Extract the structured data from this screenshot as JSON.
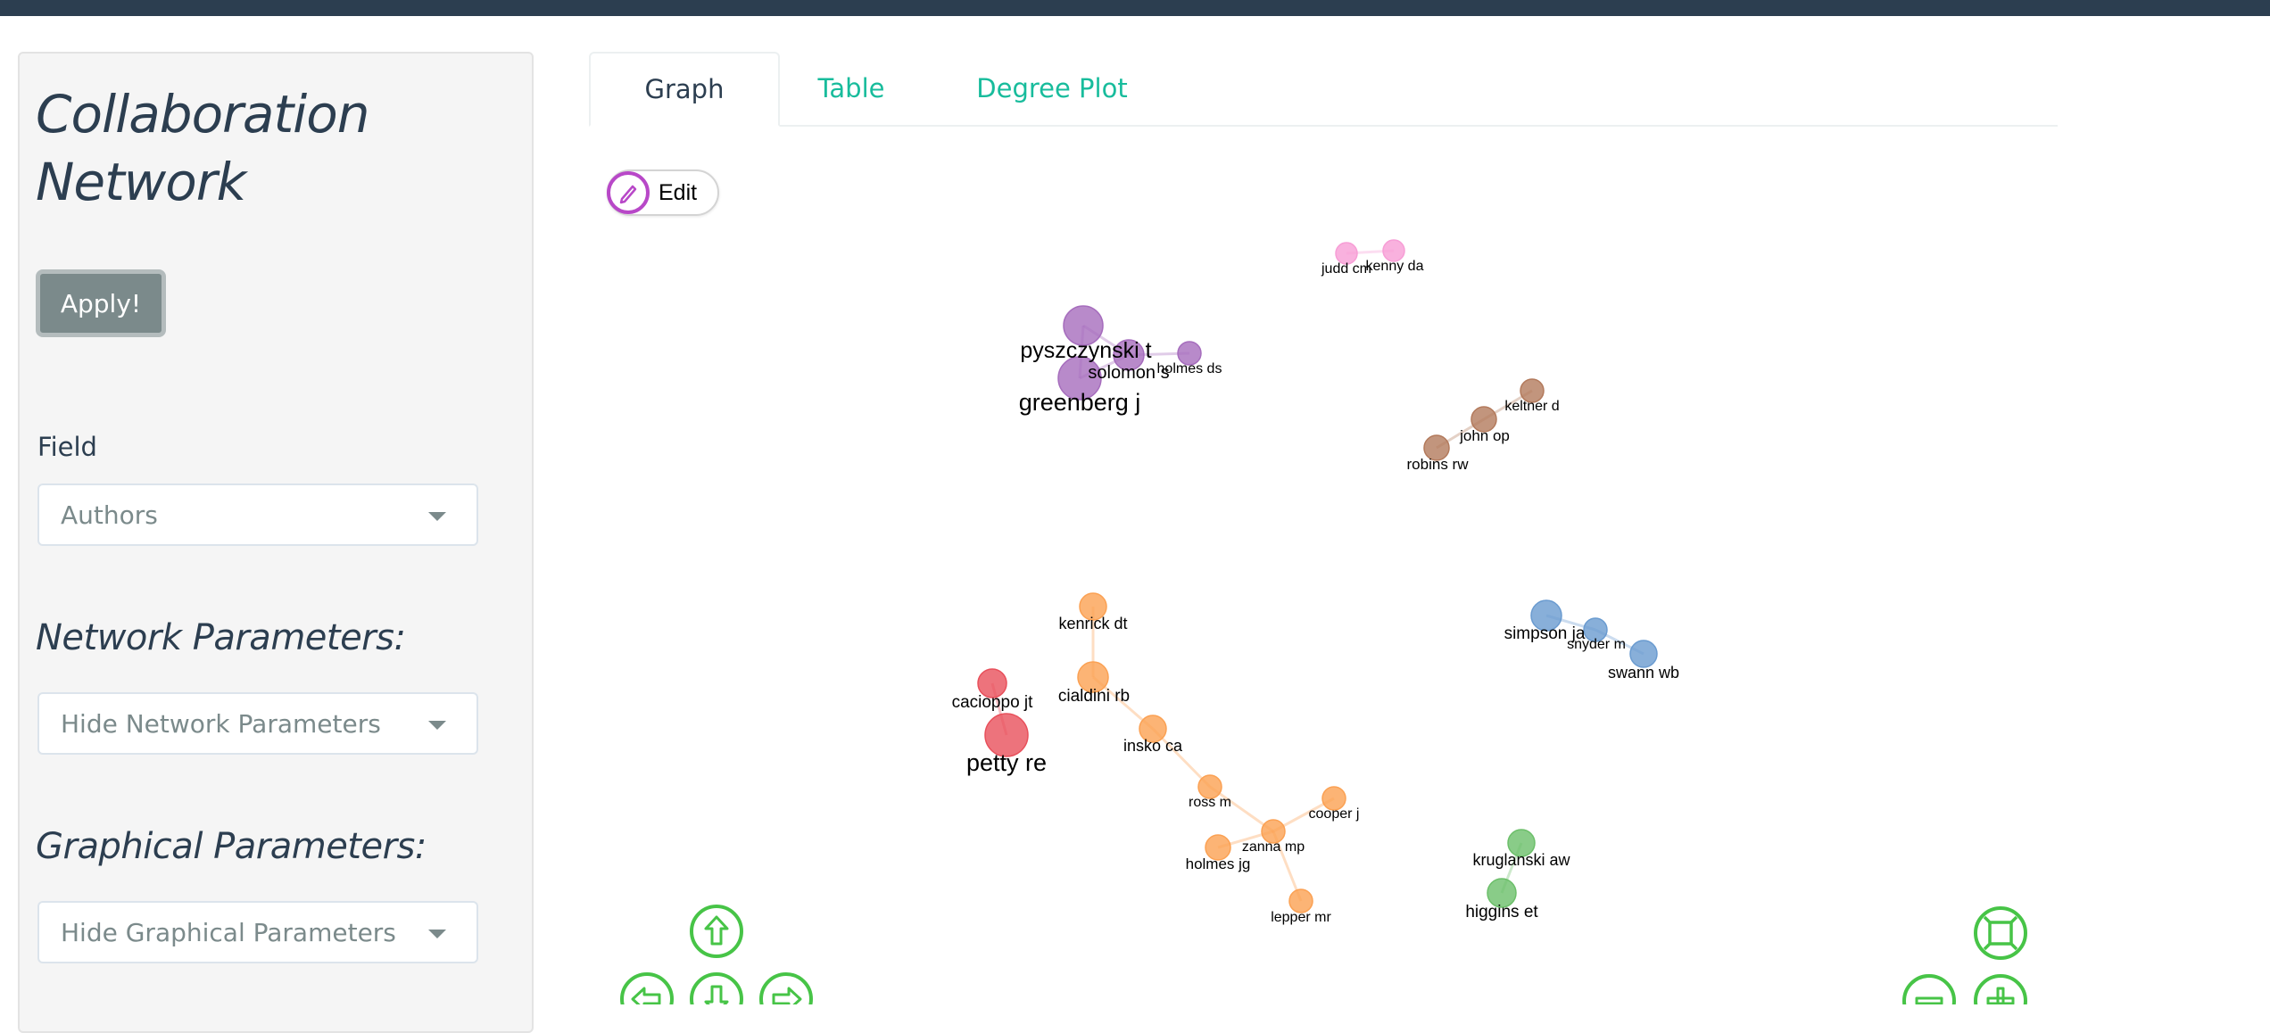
{
  "sidebar": {
    "title": "Collaboration Network",
    "apply_label": "Apply!",
    "field_label": "Field",
    "field_value": "Authors",
    "network_heading": "Network Parameters:",
    "network_select": "Hide Network Parameters",
    "graphical_heading": "Graphical Parameters:",
    "graphical_select": "Hide Graphical Parameters"
  },
  "tabs": [
    {
      "label": "Graph",
      "active": true
    },
    {
      "label": "Table",
      "active": false
    },
    {
      "label": "Degree Plot",
      "active": false
    }
  ],
  "graph": {
    "edit_label": "Edit",
    "node_colors": {
      "pink": "#f79ed6",
      "purple": "#a66dbd",
      "brown": "#b37a5c",
      "blue": "#6a9bd0",
      "orange": "#fba153",
      "red": "#e8505b",
      "green": "#6cbf6a"
    },
    "nodes": [
      {
        "id": "judd",
        "label": "judd cm",
        "color": "pink"
      },
      {
        "id": "kenny",
        "label": "kenny da",
        "color": "pink"
      },
      {
        "id": "pyszczynski",
        "label": "pyszczynski t",
        "color": "purple"
      },
      {
        "id": "solomon",
        "label": "solomon s",
        "color": "purple"
      },
      {
        "id": "holmesds",
        "label": "holmes ds",
        "color": "purple"
      },
      {
        "id": "greenberg",
        "label": "greenberg j",
        "color": "purple"
      },
      {
        "id": "keltner",
        "label": "keltner d",
        "color": "brown"
      },
      {
        "id": "john",
        "label": "john op",
        "color": "brown"
      },
      {
        "id": "robins",
        "label": "robins rw",
        "color": "brown"
      },
      {
        "id": "kenrick",
        "label": "kenrick dt",
        "color": "orange"
      },
      {
        "id": "cialdini",
        "label": "cialdini rb",
        "color": "orange"
      },
      {
        "id": "cacioppo",
        "label": "cacioppo jt",
        "color": "red"
      },
      {
        "id": "petty",
        "label": "petty re",
        "color": "red"
      },
      {
        "id": "insko",
        "label": "insko ca",
        "color": "orange"
      },
      {
        "id": "simpson",
        "label": "simpson ja",
        "color": "blue"
      },
      {
        "id": "snyder",
        "label": "snyder m",
        "color": "blue"
      },
      {
        "id": "swann",
        "label": "swann wb",
        "color": "blue"
      },
      {
        "id": "ross",
        "label": "ross m",
        "color": "orange"
      },
      {
        "id": "cooper",
        "label": "cooper j",
        "color": "orange"
      },
      {
        "id": "zanna",
        "label": "zanna mp",
        "color": "orange"
      },
      {
        "id": "holmesjg",
        "label": "holmes jg",
        "color": "orange"
      },
      {
        "id": "lepper",
        "label": "lepper mr",
        "color": "orange"
      },
      {
        "id": "kruglanski",
        "label": "kruglanski aw",
        "color": "green"
      },
      {
        "id": "higgins",
        "label": "higgins et",
        "color": "green"
      }
    ],
    "edges": [
      [
        "judd",
        "kenny"
      ],
      [
        "pyszczynski",
        "solomon"
      ],
      [
        "pyszczynski",
        "greenberg"
      ],
      [
        "solomon",
        "greenberg"
      ],
      [
        "solomon",
        "holmesds"
      ],
      [
        "keltner",
        "john"
      ],
      [
        "john",
        "robins"
      ],
      [
        "kenrick",
        "cialdini"
      ],
      [
        "cialdini",
        "insko"
      ],
      [
        "cacioppo",
        "petty"
      ],
      [
        "insko",
        "ross"
      ],
      [
        "ross",
        "zanna"
      ],
      [
        "zanna",
        "cooper"
      ],
      [
        "zanna",
        "holmesjg"
      ],
      [
        "zanna",
        "lepper"
      ],
      [
        "simpson",
        "snyder"
      ],
      [
        "snyder",
        "swann"
      ],
      [
        "kruglanski",
        "higgins"
      ]
    ],
    "nav_icons": [
      "arrow-up-icon",
      "arrow-left-icon",
      "arrow-down-icon",
      "arrow-right-icon",
      "fit-icon",
      "zoom-out-icon",
      "zoom-in-icon"
    ],
    "nav_color": "#47c447"
  }
}
